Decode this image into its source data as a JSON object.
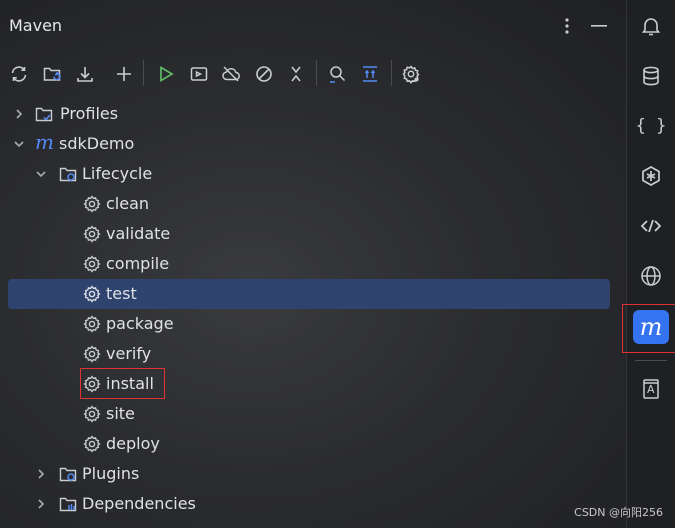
{
  "header": {
    "title": "Maven",
    "more_icon": "more-vertical-icon",
    "minimize_icon": "minimize-icon"
  },
  "toolbar": {
    "icons": [
      "reload-icon",
      "add-folder-icon",
      "download-icon",
      "add-icon",
      "run-icon",
      "run-config-icon",
      "offline-icon",
      "skip-tests-icon",
      "collapse-icon",
      "analyze-icon",
      "show-dependencies-icon",
      "settings-icon"
    ]
  },
  "tree": {
    "profiles": "Profiles",
    "project": "sdkDemo",
    "project_glyph": "m",
    "lifecycle": "Lifecycle",
    "goals": [
      "clean",
      "validate",
      "compile",
      "test",
      "package",
      "verify",
      "install",
      "site",
      "deploy"
    ],
    "selected_goal": "test",
    "highlighted_goal": "install",
    "plugins": "Plugins",
    "dependencies": "Dependencies"
  },
  "sidebar": {
    "icons": [
      "notifications-icon",
      "database-icon",
      "json-icon",
      "ai-assistant-icon",
      "endpoints-icon",
      "web-icon",
      "maven-icon",
      "documentation-icon"
    ],
    "active": "maven-icon",
    "maven_glyph": "m",
    "doc_glyph": "A",
    "json_glyph": "{ }"
  },
  "watermark": "CSDN @向阳256",
  "colors": {
    "selection": "#2e436e",
    "accent": "#3574f0",
    "highlight_box": "#e03232",
    "run_green": "#5fb865",
    "maven_blue": "#548af7"
  }
}
